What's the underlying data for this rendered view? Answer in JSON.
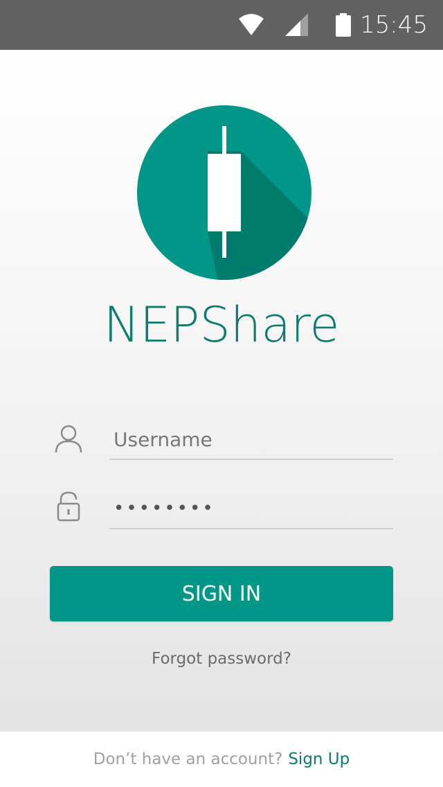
{
  "status_bar": {
    "time": "15:45",
    "icons": [
      "wifi-icon",
      "signal-icon",
      "battery-icon"
    ]
  },
  "app": {
    "name": "NEPShare",
    "logo_icon": "candlestick-logo-icon",
    "accent_color": "#009688",
    "brand_color": "#0f7b6c"
  },
  "login": {
    "username": {
      "placeholder": "Username",
      "value": "",
      "icon": "user-icon"
    },
    "password": {
      "value": "••••••••",
      "icon": "lock-icon"
    },
    "sign_in_label": "SIGN IN",
    "forgot_label": "Forgot password?"
  },
  "footer": {
    "prompt": "Don’t have an account?",
    "signup_label": "Sign Up"
  }
}
